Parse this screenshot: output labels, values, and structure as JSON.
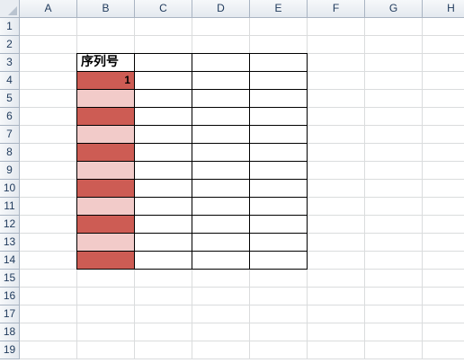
{
  "columns": [
    "A",
    "B",
    "C",
    "D",
    "E",
    "F",
    "G",
    "H"
  ],
  "rows": [
    "1",
    "2",
    "3",
    "4",
    "5",
    "6",
    "7",
    "8",
    "9",
    "10",
    "11",
    "12",
    "13",
    "14",
    "15",
    "16",
    "17",
    "18",
    "19"
  ],
  "table": {
    "header": "序列号",
    "first_value": "1",
    "colors": {
      "dark_fill": "#cd5c54",
      "light_fill": "#f2cbc9",
      "border": "#000000"
    }
  }
}
